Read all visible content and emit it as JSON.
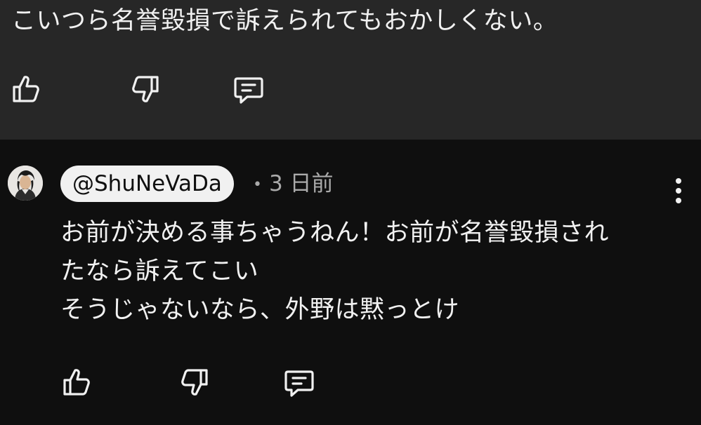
{
  "top_comment": {
    "text": "こいつら名誉毀損で訴えられてもおかしくない。",
    "actions": {
      "like_icon": "thumbs-up-icon",
      "dislike_icon": "thumbs-down-icon",
      "reply_icon": "comment-icon"
    }
  },
  "reply": {
    "author": "@ShuNeVaDa",
    "separator": "•",
    "time": "3 日前",
    "body_lines": [
      "お前が決める事ちゃうねん！お前が名誉毀損され",
      "たなら訴えてこい",
      "そうじゃないなら、外野は黙っとけ"
    ],
    "more_icon": "more-vertical-icon",
    "actions": {
      "like_icon": "thumbs-up-icon",
      "dislike_icon": "thumbs-down-icon",
      "reply_icon": "comment-icon"
    }
  },
  "colors": {
    "top_background": "#272727",
    "page_background": "#0f0f0f",
    "text": "#f1f1f1",
    "meta_text": "#aaaaaa",
    "author_chip_background": "#f1f1f1",
    "author_chip_text": "#0f0f0f"
  }
}
